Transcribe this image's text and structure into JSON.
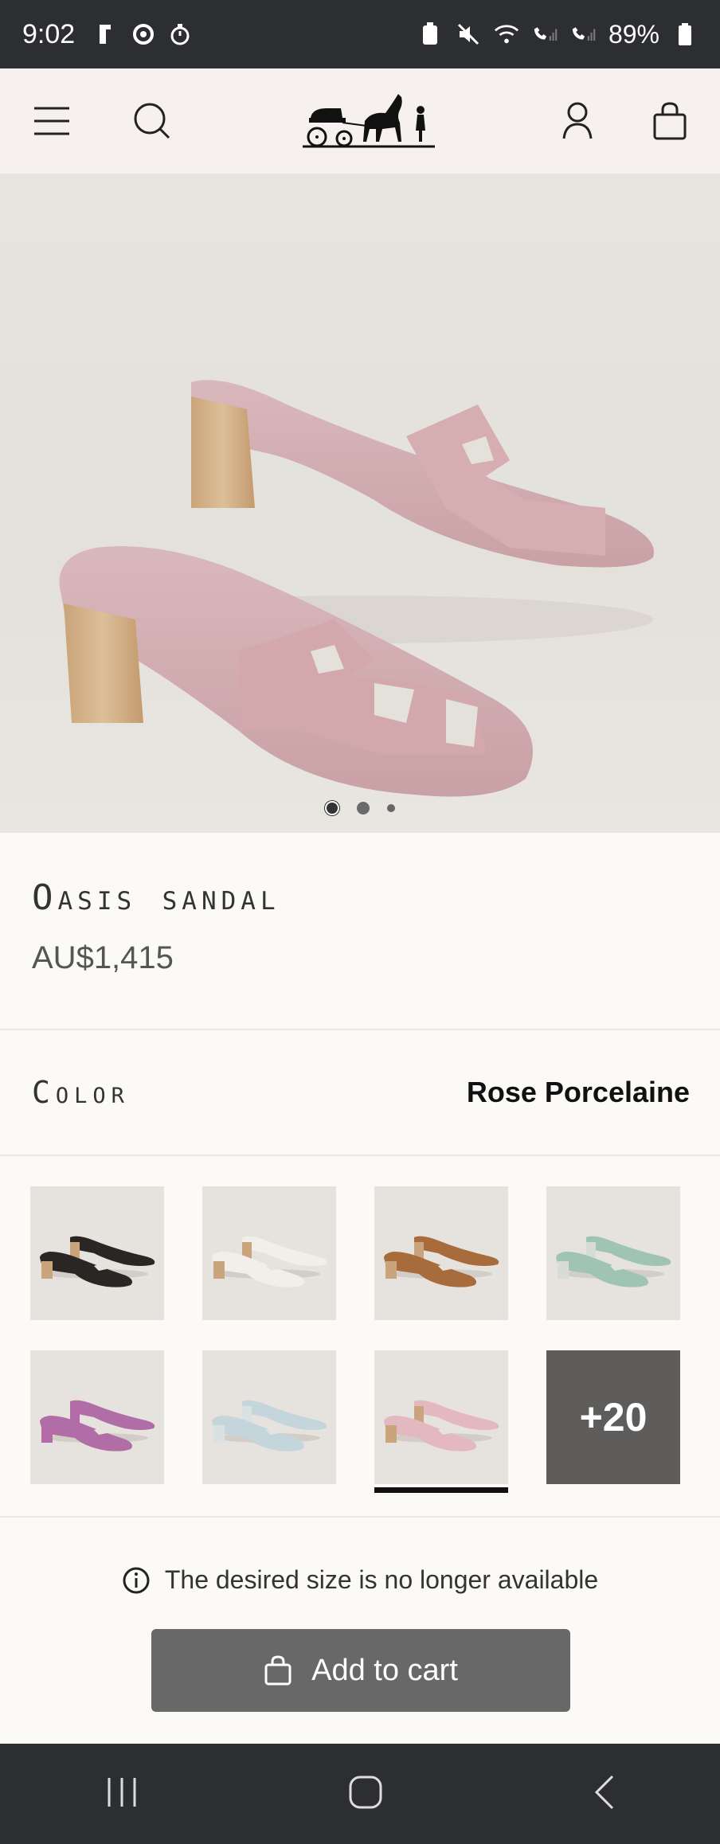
{
  "status": {
    "time": "9:02",
    "battery": "89%"
  },
  "product": {
    "title": "Oasis sandal",
    "price": "AU$1,415",
    "color_label": "Color",
    "color_value": "Rose Porcelaine"
  },
  "gallery": {
    "slide_count": 3,
    "active_slide": 1
  },
  "swatches": [
    {
      "name": "black",
      "color": "#2a2624",
      "heel": "#c9a47c"
    },
    {
      "name": "white",
      "color": "#f2efea",
      "heel": "#c9a47c"
    },
    {
      "name": "gold",
      "color": "#a86b3b",
      "heel": "#c9a47c"
    },
    {
      "name": "mint",
      "color": "#9fc4b4",
      "heel": "#d8dcd8"
    },
    {
      "name": "purple",
      "color": "#b16ea6",
      "heel": "#b56ba8"
    },
    {
      "name": "light-blue",
      "color": "#c4d6dc",
      "heel": "#d9e1e3"
    },
    {
      "name": "rose-porcelaine",
      "color": "#e3b8bf",
      "heel": "#c9a47c",
      "selected": true
    }
  ],
  "more_swatches_label": "+20",
  "availability_text": "The desired size is no longer available",
  "cart_label": "Add to cart",
  "colors": {
    "status_bar": "#2d2e31",
    "header_bg": "#f6f1ee",
    "cart_button": "#686868"
  }
}
